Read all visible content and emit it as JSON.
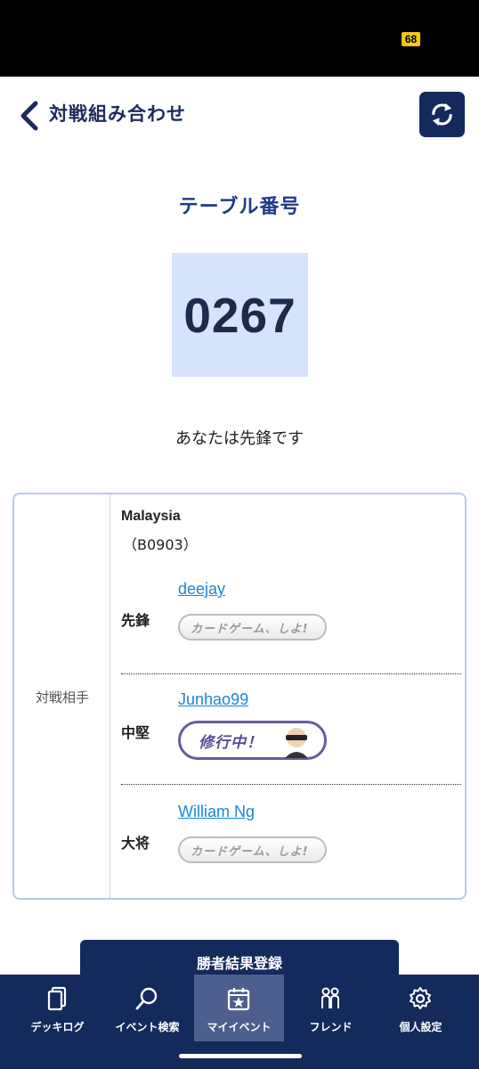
{
  "status_bar": {
    "battery": "68"
  },
  "header": {
    "title": "対戦組み合わせ"
  },
  "table": {
    "label": "テーブル番号",
    "number": "0267"
  },
  "position_text": "あなたは先鋒です",
  "opponent": {
    "label": "対戦相手",
    "team_name": "Malaysia",
    "team_code": "（B0903）",
    "members": [
      {
        "role": "先鋒",
        "name": "deejay",
        "badge": "カードゲーム、しよ!"
      },
      {
        "role": "中堅",
        "name": "Junhao99",
        "badge": "修行中！"
      },
      {
        "role": "大将",
        "name": "William Ng",
        "badge": "カードゲーム、しよ!"
      }
    ]
  },
  "submit_button": "勝者結果登録",
  "tabs": [
    {
      "label": "デッキログ",
      "icon": "deck-log-icon"
    },
    {
      "label": "イベント検索",
      "icon": "search-icon"
    },
    {
      "label": "マイイベント",
      "icon": "calendar-star-icon"
    },
    {
      "label": "フレンド",
      "icon": "friends-icon"
    },
    {
      "label": "個人設定",
      "icon": "gear-icon"
    }
  ],
  "colors": {
    "navy": "#142a5c",
    "accent_blue": "#1d3a8a",
    "link": "#1a86d9",
    "table_box": "#d6e3fa"
  }
}
